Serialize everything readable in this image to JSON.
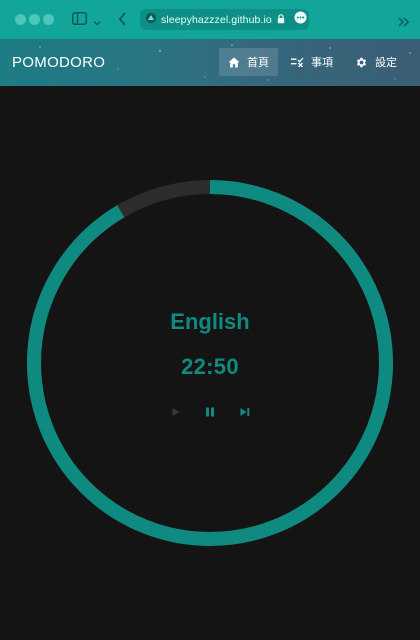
{
  "browser": {
    "url": "sleepyhazzzel.github.io"
  },
  "header": {
    "app_title": "POMODORO",
    "nav": [
      {
        "label": "首頁",
        "icon": "home-icon",
        "active": true
      },
      {
        "label": "事項",
        "icon": "checklist-icon",
        "active": false
      },
      {
        "label": "設定",
        "icon": "gear-icon",
        "active": false
      }
    ]
  },
  "timer": {
    "task_name": "English",
    "time_remaining": "22:50",
    "progress_remaining_fraction": 0.915,
    "controls": [
      {
        "name": "play",
        "icon": "play-icon",
        "enabled": false
      },
      {
        "name": "pause",
        "icon": "pause-icon",
        "enabled": true
      },
      {
        "name": "skip",
        "icon": "skip-next-icon",
        "enabled": true
      }
    ]
  },
  "colors": {
    "accent": "#0f8a80",
    "ring_track": "#2c2c2c",
    "background": "#141414",
    "chrome": "#12a69b"
  }
}
